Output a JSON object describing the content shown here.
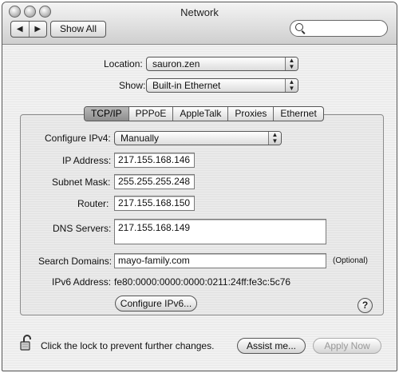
{
  "window": {
    "title": "Network"
  },
  "toolbar": {
    "back_label": "◀",
    "forward_label": "▶",
    "show_all_label": "Show All",
    "search_value": ""
  },
  "location": {
    "label": "Location:",
    "value": "sauron.zen"
  },
  "show": {
    "label": "Show:",
    "value": "Built-in Ethernet"
  },
  "tabs": [
    {
      "label": "TCP/IP",
      "selected": true
    },
    {
      "label": "PPPoE"
    },
    {
      "label": "AppleTalk"
    },
    {
      "label": "Proxies"
    },
    {
      "label": "Ethernet"
    }
  ],
  "tcpip": {
    "configure_label": "Configure IPv4:",
    "configure_value": "Manually",
    "ip_label": "IP Address:",
    "ip_value": "217.155.168.146",
    "subnet_label": "Subnet Mask:",
    "subnet_value": "255.255.255.248",
    "router_label": "Router:",
    "router_value": "217.155.168.150",
    "dns_label": "DNS Servers:",
    "dns_value": "217.155.168.149",
    "search_label": "Search Domains:",
    "search_value": "mayo-family.com",
    "search_optional": "(Optional)",
    "ipv6_label": "IPv6 Address:",
    "ipv6_value": "fe80:0000:0000:0000:0211:24ff:fe3c:5c76",
    "configure_ipv6_label": "Configure IPv6..."
  },
  "help_label": "?",
  "footer": {
    "lock_text": "Click the lock to prevent further changes.",
    "assist_label": "Assist me...",
    "apply_label": "Apply Now"
  }
}
